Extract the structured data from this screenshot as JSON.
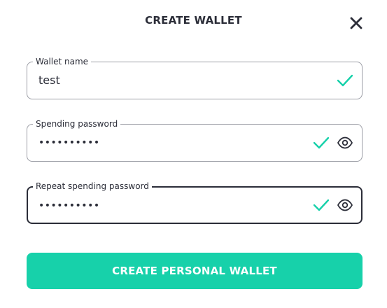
{
  "dialog": {
    "title": "CREATE WALLET",
    "close_icon": "close-icon"
  },
  "fields": [
    {
      "label": "Wallet name",
      "value": "test",
      "valid": true
    },
    {
      "label": "Spending password",
      "value": "••••••••••",
      "masked": true,
      "valid": true,
      "toggle_icon": "eye-icon"
    },
    {
      "label": "Repeat spending password",
      "value": "••••••••••",
      "masked": true,
      "valid": true,
      "focused": true,
      "toggle_icon": "eye-icon"
    }
  ],
  "submit": {
    "label": "CREATE PERSONAL WALLET"
  },
  "colors": {
    "accent": "#17d1aa",
    "text": "#2b2d38",
    "border": "#9c9ea6"
  }
}
